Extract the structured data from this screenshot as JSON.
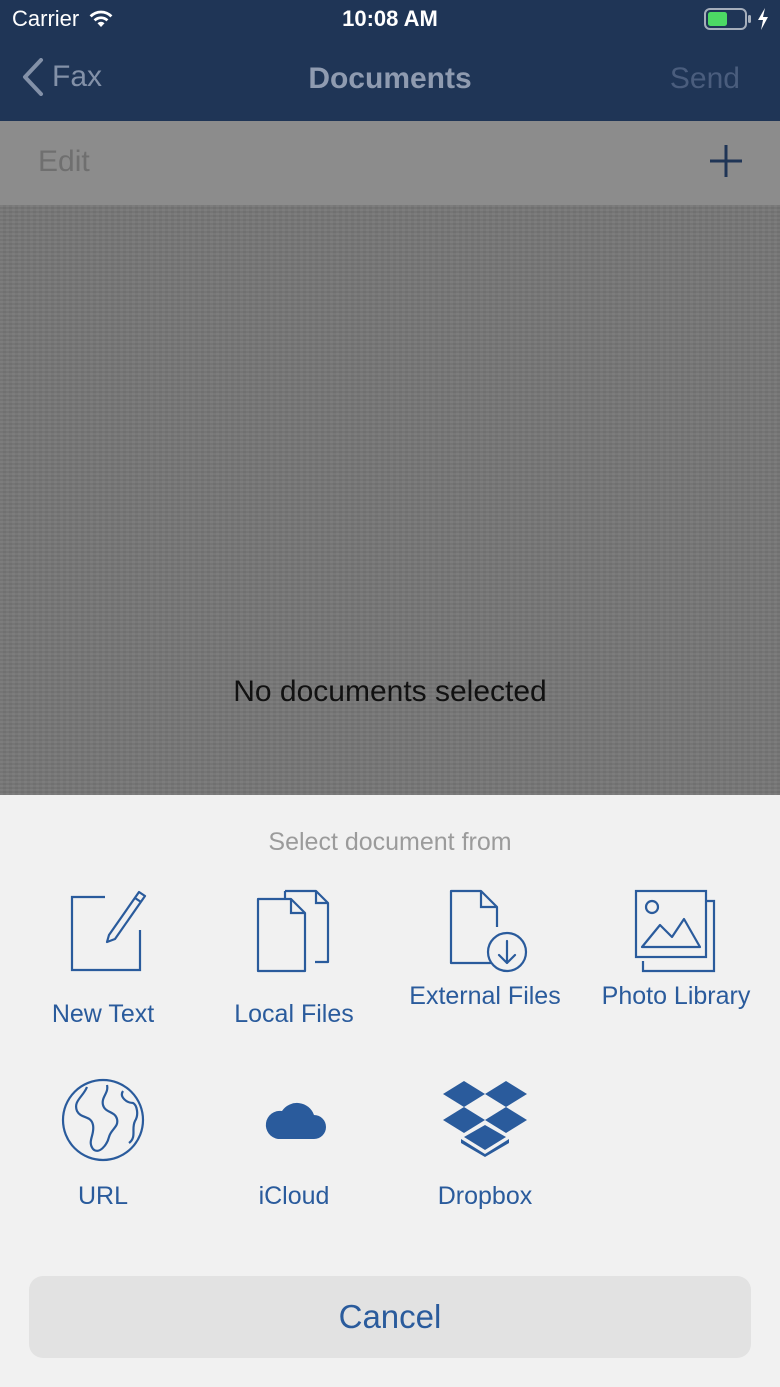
{
  "status_bar": {
    "carrier": "Carrier",
    "time": "10:08 AM",
    "wifi_icon": "wifi-icon",
    "battery_icon": "battery-icon",
    "charging_icon": "bolt-icon"
  },
  "nav": {
    "back_label": "Fax",
    "title": "Documents",
    "send_label": "Send"
  },
  "toolbar": {
    "edit_label": "Edit",
    "add_icon": "plus-icon"
  },
  "content": {
    "empty_message": "No documents selected"
  },
  "sheet": {
    "title": "Select document from",
    "options": [
      {
        "label": "New Text",
        "icon": "new-text-icon"
      },
      {
        "label": "Local Files",
        "icon": "local-files-icon"
      },
      {
        "label": "External Files",
        "icon": "external-files-icon"
      },
      {
        "label": "Photo Library",
        "icon": "photo-library-icon"
      },
      {
        "label": "URL",
        "icon": "globe-icon"
      },
      {
        "label": "iCloud",
        "icon": "cloud-icon"
      },
      {
        "label": "Dropbox",
        "icon": "dropbox-icon"
      }
    ],
    "cancel_label": "Cancel"
  },
  "colors": {
    "nav_bg": "#1f3556",
    "accent": "#2a5b9c",
    "sheet_bg": "#f1f1f1",
    "battery_green": "#4cd964"
  }
}
